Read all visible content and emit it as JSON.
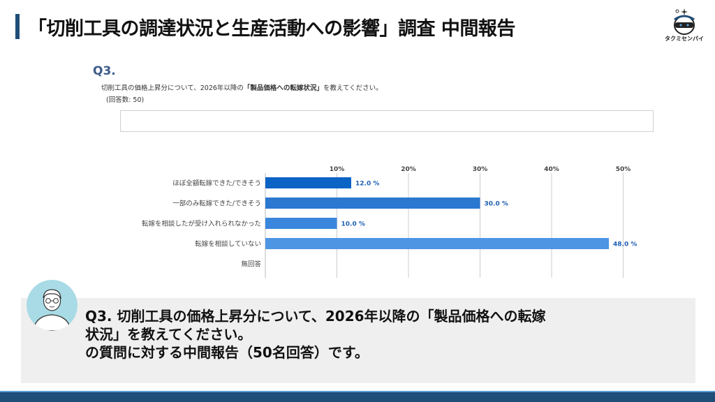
{
  "header": {
    "title": "「切削工具の調達状況と生産活動への影響」調査 中間報告",
    "logo_text": "タクミセンパイ",
    "logo_icon": "robot-mascot-icon"
  },
  "question": {
    "number": "Q3.",
    "text_before": "切削工具の価格上昇分について、2026年以降の",
    "text_bold": "「製品価格への転嫁状況」",
    "text_after": "を教えてください。",
    "count": "(回答数: 50)"
  },
  "chart_data": {
    "type": "bar",
    "orientation": "horizontal",
    "categories": [
      "ほぼ全額転嫁できた/できそう",
      "一部のみ転嫁できた/できそう",
      "転嫁を相談したが受け入れられなかった",
      "転嫁を相談していない",
      "無回答"
    ],
    "values": [
      12.0,
      30.0,
      10.0,
      48.0,
      0
    ],
    "value_labels": [
      "12.0 %",
      "30.0 %",
      "10.0 %",
      "48.0 %",
      ""
    ],
    "ticks": [
      "10%",
      "20%",
      "30%",
      "40%",
      "50%"
    ],
    "xlim": [
      0,
      50
    ],
    "grid": true,
    "colors": [
      "#0b63c5",
      "#2a78d0",
      "#3a86dc",
      "#4e95e4",
      "#4e95e4"
    ],
    "label_color": "#1f5fb4"
  },
  "comment": {
    "line1": "Q3.  切削工具の価格上昇分について、2026年以降の「製品価格への転嫁",
    "line2": "状況」を教えてください。",
    "line3": "の質問に対する中間報告（50名回答）です。",
    "avatar_icon": "person-avatar-icon"
  },
  "colors": {
    "accent": "#1f4e79",
    "footer_light": "#5aa0d8",
    "comment_bg": "#efefef"
  }
}
